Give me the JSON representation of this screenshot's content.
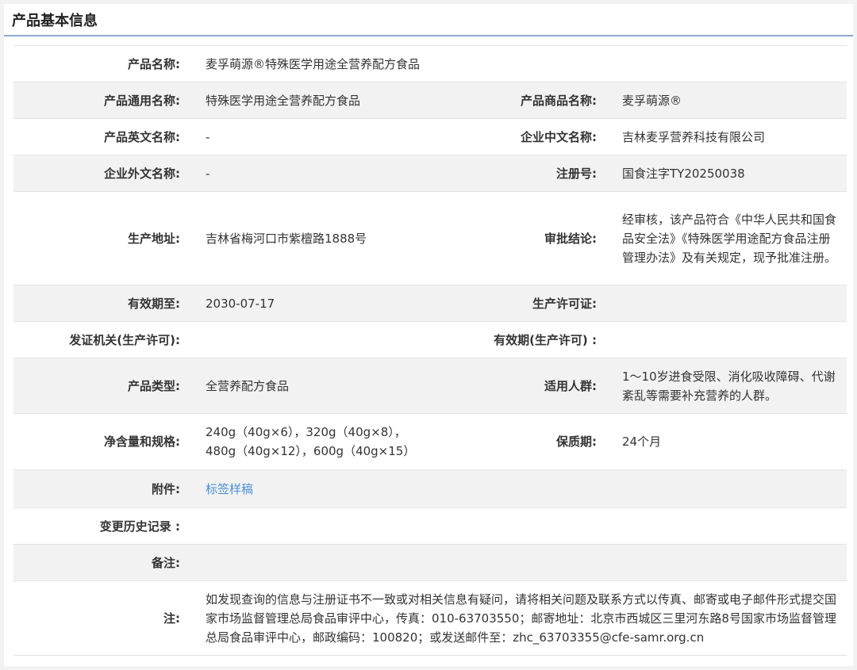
{
  "panel": {
    "title": "产品基本信息"
  },
  "fields": {
    "product_name": {
      "label": "产品名称:",
      "value": "麦孚萌源®特殊医学用途全营养配方食品"
    },
    "generic_name": {
      "label": "产品通用名称:",
      "value": "特殊医学用途全营养配方食品"
    },
    "trade_name": {
      "label": "产品商品名称:",
      "value": "麦孚萌源®"
    },
    "english_name": {
      "label": "产品英文名称:",
      "value": "-"
    },
    "company_cn": {
      "label": "企业中文名称:",
      "value": "吉林麦孚营养科技有限公司"
    },
    "company_foreign": {
      "label": "企业外文名称:",
      "value": "-"
    },
    "reg_no": {
      "label": "注册号:",
      "value": "国食注字TY20250038"
    },
    "address": {
      "label": "生产地址:",
      "value": "吉林省梅河口市紫檀路1888号"
    },
    "conclusion": {
      "label": "审批结论:",
      "value": "经审核，该产品符合《中华人民共和国食品安全法》《特殊医学用途配方食品注册管理办法》及有关规定，现予批准注册。"
    },
    "valid_until": {
      "label": "有效期至:",
      "value": "2030-07-17"
    },
    "prod_license": {
      "label": "生产许可证:",
      "value": ""
    },
    "issuing_authority": {
      "label": "发证机关(生产许可):",
      "value": ""
    },
    "license_validity": {
      "label": "有效期(生产许可) :",
      "value": ""
    },
    "product_type": {
      "label": "产品类型:",
      "value": "全营养配方食品"
    },
    "target_group": {
      "label": "适用人群:",
      "value": "1～10岁进食受限、消化吸收障碍、代谢紊乱等需要补充营养的人群。"
    },
    "net_content": {
      "label": "净含量和规格:",
      "line1": "240g（40g×6），320g（40g×8），",
      "line2": "480g（40g×12），600g（40g×15）"
    },
    "shelf_life": {
      "label": "保质期:",
      "value": "24个月"
    },
    "attachment": {
      "label": "附件:",
      "link": "标签样稿"
    },
    "change_history": {
      "label": "变更历史记录 :",
      "value": ""
    },
    "remarks": {
      "label": "备注:",
      "value": ""
    },
    "note": {
      "label": "注:",
      "value": "如发现查询的信息与注册证书不一致或对相关信息有疑问，请将相关问题及联系方式以传真、邮寄或电子邮件形式提交国家市场监督管理总局食品审评中心，传真：010-63703550；邮寄地址：北京市西城区三里河东路8号国家市场监督管理总局食品审评中心，邮政编码：100820；或发送邮件至：zhc_63703355@cfe-samr.org.cn"
    }
  }
}
